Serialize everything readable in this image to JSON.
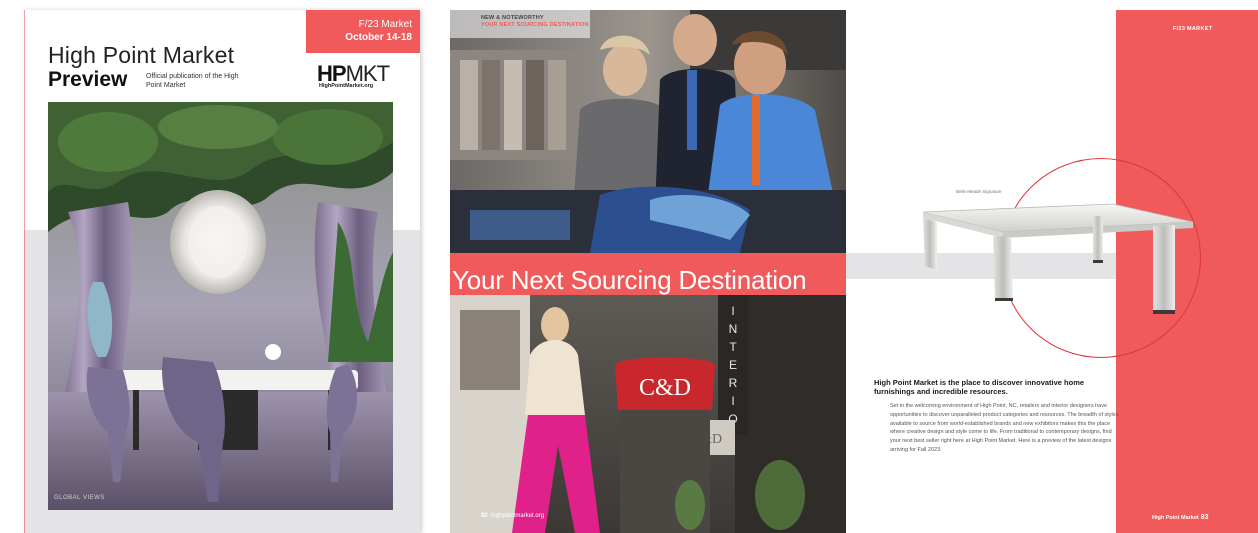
{
  "cover": {
    "title_line1": "High Point Market",
    "title_line2": "Preview",
    "subtitle": "Official publication of the High Point Market",
    "market_label": "F/23 Market",
    "market_dates": "October 14-18",
    "logo_bold": "HP",
    "logo_thin": "MKT",
    "logo_url": "HighPointMarket.org",
    "photo_credit": "GLOBAL VIEWS"
  },
  "spread_left": {
    "kicker": "NEW & NOTEWORTHY",
    "kicker_sub": "YOUR NEXT SOURCING DESTINATION",
    "headline": "Your Next Sourcing Destination",
    "page_number": "82",
    "page_url": "highpointmarket.org",
    "storefront_sign": "C&D",
    "banner_text": "INTERIOR"
  },
  "spread_right": {
    "market_label": "F/23 MARKET",
    "product_caption": "Belle Meade Signature",
    "body_heading": "High Point Market is the place to discover innovative home furnishings and incredible resources.",
    "body_text": "Set in the welcoming environment of High Point, NC, retailers and interior designers have opportunities to discover unparalleled product categories and resources. The breadth of styles available to source from world-established brands and new exhibitors makes this the place where creative design and style come to life. From traditional to contemporary designs, find your next best seller right here at High Point Market. Here is a preview of the latest designs arriving for Fall 2023.",
    "folio_label": "High Point Market",
    "page_number": "83"
  },
  "colors": {
    "accent_red": "#f05a5a",
    "band_gray": "#e4e4e6"
  }
}
